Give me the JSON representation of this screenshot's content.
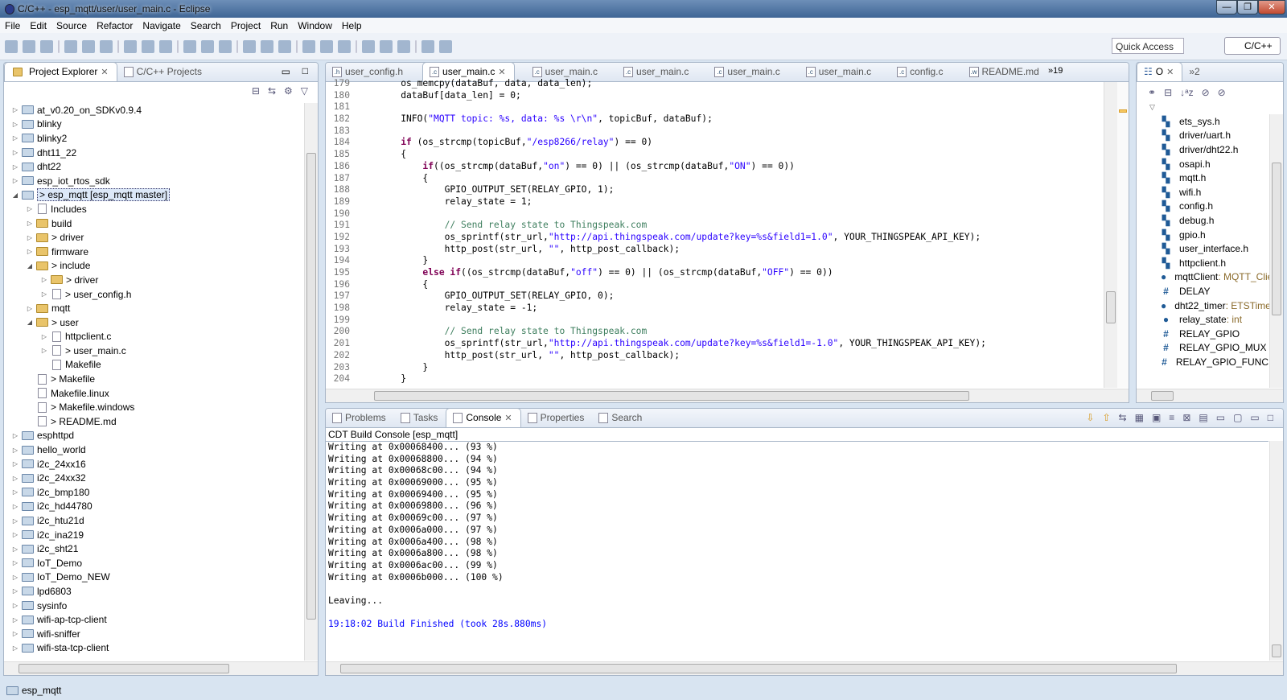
{
  "window": {
    "title": "C/C++ - esp_mqtt/user/user_main.c - Eclipse",
    "buttons": [
      "—",
      "❐",
      "✕"
    ]
  },
  "menu": [
    "File",
    "Edit",
    "Source",
    "Refactor",
    "Navigate",
    "Search",
    "Project",
    "Run",
    "Window",
    "Help"
  ],
  "toolbar": {
    "quick_access": "Quick Access",
    "perspective": "C/C++"
  },
  "explorer": {
    "tabs": [
      {
        "label": "Project Explorer"
      },
      {
        "label": "C/C++ Projects"
      }
    ],
    "items": [
      {
        "d": 0,
        "t": "▷",
        "k": "prj",
        "label": "at_v0.20_on_SDKv0.9.4"
      },
      {
        "d": 0,
        "t": "▷",
        "k": "prj",
        "label": "blinky"
      },
      {
        "d": 0,
        "t": "▷",
        "k": "prj",
        "label": "blinky2"
      },
      {
        "d": 0,
        "t": "▷",
        "k": "prj",
        "label": "dht11_22"
      },
      {
        "d": 0,
        "t": "▷",
        "k": "prj",
        "label": "dht22"
      },
      {
        "d": 0,
        "t": "▷",
        "k": "prj",
        "label": "esp_iot_rtos_sdk"
      },
      {
        "d": 0,
        "t": "◢",
        "k": "prj",
        "label": "> esp_mqtt  [esp_mqtt master]",
        "sel": true
      },
      {
        "d": 1,
        "t": "▷",
        "k": "inc",
        "label": "Includes"
      },
      {
        "d": 1,
        "t": "▷",
        "k": "fo",
        "label": "build"
      },
      {
        "d": 1,
        "t": "▷",
        "k": "fo",
        "label": "> driver"
      },
      {
        "d": 1,
        "t": "▷",
        "k": "fo",
        "label": "firmware"
      },
      {
        "d": 1,
        "t": "◢",
        "k": "fo",
        "label": "> include"
      },
      {
        "d": 2,
        "t": "▷",
        "k": "fo",
        "label": "> driver"
      },
      {
        "d": 2,
        "t": "▷",
        "k": "fi",
        "label": "> user_config.h"
      },
      {
        "d": 1,
        "t": "▷",
        "k": "fo",
        "label": "mqtt"
      },
      {
        "d": 1,
        "t": "◢",
        "k": "fo",
        "label": "> user"
      },
      {
        "d": 2,
        "t": "▷",
        "k": "fi",
        "label": "httpclient.c"
      },
      {
        "d": 2,
        "t": "▷",
        "k": "fi",
        "label": "> user_main.c"
      },
      {
        "d": 2,
        "t": "",
        "k": "fi",
        "label": "Makefile"
      },
      {
        "d": 1,
        "t": "",
        "k": "fi",
        "label": "> Makefile"
      },
      {
        "d": 1,
        "t": "",
        "k": "fi",
        "label": "Makefile.linux"
      },
      {
        "d": 1,
        "t": "",
        "k": "fi",
        "label": "> Makefile.windows"
      },
      {
        "d": 1,
        "t": "",
        "k": "fi",
        "label": "> README.md"
      },
      {
        "d": 0,
        "t": "▷",
        "k": "prj",
        "label": "esphttpd"
      },
      {
        "d": 0,
        "t": "▷",
        "k": "prj",
        "label": "hello_world"
      },
      {
        "d": 0,
        "t": "▷",
        "k": "prj",
        "label": "i2c_24xx16"
      },
      {
        "d": 0,
        "t": "▷",
        "k": "prj",
        "label": "i2c_24xx32"
      },
      {
        "d": 0,
        "t": "▷",
        "k": "prj",
        "label": "i2c_bmp180"
      },
      {
        "d": 0,
        "t": "▷",
        "k": "prj",
        "label": "i2c_hd44780"
      },
      {
        "d": 0,
        "t": "▷",
        "k": "prj",
        "label": "i2c_htu21d"
      },
      {
        "d": 0,
        "t": "▷",
        "k": "prj",
        "label": "i2c_ina219"
      },
      {
        "d": 0,
        "t": "▷",
        "k": "prj",
        "label": "i2c_sht21"
      },
      {
        "d": 0,
        "t": "▷",
        "k": "prj",
        "label": "IoT_Demo"
      },
      {
        "d": 0,
        "t": "▷",
        "k": "prj",
        "label": "IoT_Demo_NEW"
      },
      {
        "d": 0,
        "t": "▷",
        "k": "prj",
        "label": "lpd6803"
      },
      {
        "d": 0,
        "t": "▷",
        "k": "prj",
        "label": "sysinfo"
      },
      {
        "d": 0,
        "t": "▷",
        "k": "prj",
        "label": "wifi-ap-tcp-client"
      },
      {
        "d": 0,
        "t": "▷",
        "k": "prj",
        "label": "wifi-sniffer"
      },
      {
        "d": 0,
        "t": "▷",
        "k": "prj",
        "label": "wifi-sta-tcp-client"
      }
    ]
  },
  "editor": {
    "tabs": [
      {
        "label": "user_config.h",
        "i": "h"
      },
      {
        "label": "user_main.c",
        "i": "c",
        "active": true
      },
      {
        "label": "user_main.c",
        "i": "c"
      },
      {
        "label": "user_main.c",
        "i": "c"
      },
      {
        "label": "user_main.c",
        "i": "c"
      },
      {
        "label": "user_main.c",
        "i": "c"
      },
      {
        "label": "config.c",
        "i": "c"
      },
      {
        "label": "README.md",
        "i": "w"
      }
    ],
    "overflow": "»19",
    "lines": [
      {
        "n": "179",
        "s": [
          [
            "p",
            "    os_memcpy(dataBuf, data, data_len);"
          ]
        ]
      },
      {
        "n": "180",
        "s": [
          [
            "p",
            "    dataBuf[data_len] = 0;"
          ]
        ]
      },
      {
        "n": "181",
        "s": []
      },
      {
        "n": "182",
        "s": [
          [
            "p",
            "    INFO("
          ],
          [
            "st",
            "\"MQTT topic: %s, data: %s \\r\\n\""
          ],
          [
            "p",
            ", topicBuf, dataBuf);"
          ]
        ]
      },
      {
        "n": "183",
        "s": []
      },
      {
        "n": "184",
        "s": [
          [
            "p",
            "    "
          ],
          [
            "kw",
            "if"
          ],
          [
            "p",
            " (os_strcmp(topicBuf,"
          ],
          [
            "st",
            "\"/esp8266/relay\""
          ],
          [
            "p",
            ") == 0)"
          ]
        ]
      },
      {
        "n": "185",
        "s": [
          [
            "p",
            "    {"
          ]
        ]
      },
      {
        "n": "186",
        "s": [
          [
            "p",
            "        "
          ],
          [
            "kw",
            "if"
          ],
          [
            "p",
            "((os_strcmp(dataBuf,"
          ],
          [
            "st",
            "\"on\""
          ],
          [
            "p",
            ") == 0) || (os_strcmp(dataBuf,"
          ],
          [
            "st",
            "\"ON\""
          ],
          [
            "p",
            ") == 0))"
          ]
        ]
      },
      {
        "n": "187",
        "s": [
          [
            "p",
            "        {"
          ]
        ]
      },
      {
        "n": "188",
        "s": [
          [
            "p",
            "            GPIO_OUTPUT_SET(RELAY_GPIO, 1);"
          ]
        ]
      },
      {
        "n": "189",
        "s": [
          [
            "p",
            "            relay_state = 1;"
          ]
        ]
      },
      {
        "n": "190",
        "s": []
      },
      {
        "n": "191",
        "s": [
          [
            "cm",
            "            // Send relay state to Thingspeak.com"
          ]
        ]
      },
      {
        "n": "192",
        "s": [
          [
            "p",
            "            os_sprintf(str_url,"
          ],
          [
            "st",
            "\"http://api.thingspeak.com/update?key=%s&field1=1.0\""
          ],
          [
            "p",
            ", YOUR_THINGSPEAK_API_KEY);"
          ]
        ]
      },
      {
        "n": "193",
        "s": [
          [
            "p",
            "            http_post(str_url, "
          ],
          [
            "st",
            "\"\""
          ],
          [
            "p",
            ", http_post_callback);"
          ]
        ]
      },
      {
        "n": "194",
        "s": [
          [
            "p",
            "        }"
          ]
        ]
      },
      {
        "n": "195",
        "s": [
          [
            "p",
            "        "
          ],
          [
            "kw",
            "else if"
          ],
          [
            "p",
            "((os_strcmp(dataBuf,"
          ],
          [
            "st",
            "\"off\""
          ],
          [
            "p",
            ") == 0) || (os_strcmp(dataBuf,"
          ],
          [
            "st",
            "\"OFF\""
          ],
          [
            "p",
            ") == 0))"
          ]
        ]
      },
      {
        "n": "196",
        "s": [
          [
            "p",
            "        {"
          ]
        ]
      },
      {
        "n": "197",
        "s": [
          [
            "p",
            "            GPIO_OUTPUT_SET(RELAY_GPIO, 0);"
          ]
        ]
      },
      {
        "n": "198",
        "s": [
          [
            "p",
            "            relay_state = -1;"
          ]
        ]
      },
      {
        "n": "199",
        "s": []
      },
      {
        "n": "200",
        "s": [
          [
            "cm",
            "            // Send relay state to Thingspeak.com"
          ]
        ]
      },
      {
        "n": "201",
        "s": [
          [
            "p",
            "            os_sprintf(str_url,"
          ],
          [
            "st",
            "\"http://api.thingspeak.com/update?key=%s&field1=-1.0\""
          ],
          [
            "p",
            ", YOUR_THINGSPEAK_API_KEY);"
          ]
        ]
      },
      {
        "n": "202",
        "s": [
          [
            "p",
            "            http_post(str_url, "
          ],
          [
            "st",
            "\"\""
          ],
          [
            "p",
            ", http_post_callback);"
          ]
        ]
      },
      {
        "n": "203",
        "s": [
          [
            "p",
            "        }"
          ]
        ]
      },
      {
        "n": "204",
        "s": [
          [
            "p",
            "    }"
          ]
        ]
      }
    ]
  },
  "outline": {
    "tab": "O",
    "overflow": "»2",
    "items": [
      {
        "i": "inc",
        "label": "ets_sys.h"
      },
      {
        "i": "inc",
        "label": "driver/uart.h"
      },
      {
        "i": "inc",
        "label": "driver/dht22.h"
      },
      {
        "i": "inc",
        "label": "osapi.h"
      },
      {
        "i": "inc",
        "label": "mqtt.h"
      },
      {
        "i": "inc",
        "label": "wifi.h"
      },
      {
        "i": "inc",
        "label": "config.h"
      },
      {
        "i": "inc",
        "label": "debug.h"
      },
      {
        "i": "inc",
        "label": "gpio.h"
      },
      {
        "i": "inc",
        "label": "user_interface.h"
      },
      {
        "i": "inc",
        "label": "httpclient.h"
      },
      {
        "i": "var",
        "label": "mqttClient",
        "type": " : MQTT_Client"
      },
      {
        "i": "def",
        "label": "DELAY"
      },
      {
        "i": "svar",
        "label": "dht22_timer",
        "type": " : ETSTimer"
      },
      {
        "i": "svar",
        "label": "relay_state",
        "type": " : int"
      },
      {
        "i": "def",
        "label": "RELAY_GPIO"
      },
      {
        "i": "def",
        "label": "RELAY_GPIO_MUX"
      },
      {
        "i": "def",
        "label": "RELAY_GPIO_FUNC"
      }
    ]
  },
  "console": {
    "tabs": [
      {
        "label": "Problems"
      },
      {
        "label": "Tasks"
      },
      {
        "label": "Console",
        "active": true
      },
      {
        "label": "Properties"
      },
      {
        "label": "Search"
      }
    ],
    "title": "CDT Build Console [esp_mqtt]",
    "lines": [
      "Writing at 0x00068400... (93 %)",
      "Writing at 0x00068800... (94 %)",
      "Writing at 0x00068c00... (94 %)",
      "Writing at 0x00069000... (95 %)",
      "Writing at 0x00069400... (95 %)",
      "Writing at 0x00069800... (96 %)",
      "Writing at 0x00069c00... (97 %)",
      "Writing at 0x0006a000... (97 %)",
      "Writing at 0x0006a400... (98 %)",
      "Writing at 0x0006a800... (98 %)",
      "Writing at 0x0006ac00... (99 %)",
      "Writing at 0x0006b000... (100 %)",
      "",
      "Leaving...",
      ""
    ],
    "finished": "19:18:02 Build Finished (took 28s.880ms)",
    "finished_color": "#0000ff"
  },
  "status": {
    "label": "esp_mqtt"
  }
}
